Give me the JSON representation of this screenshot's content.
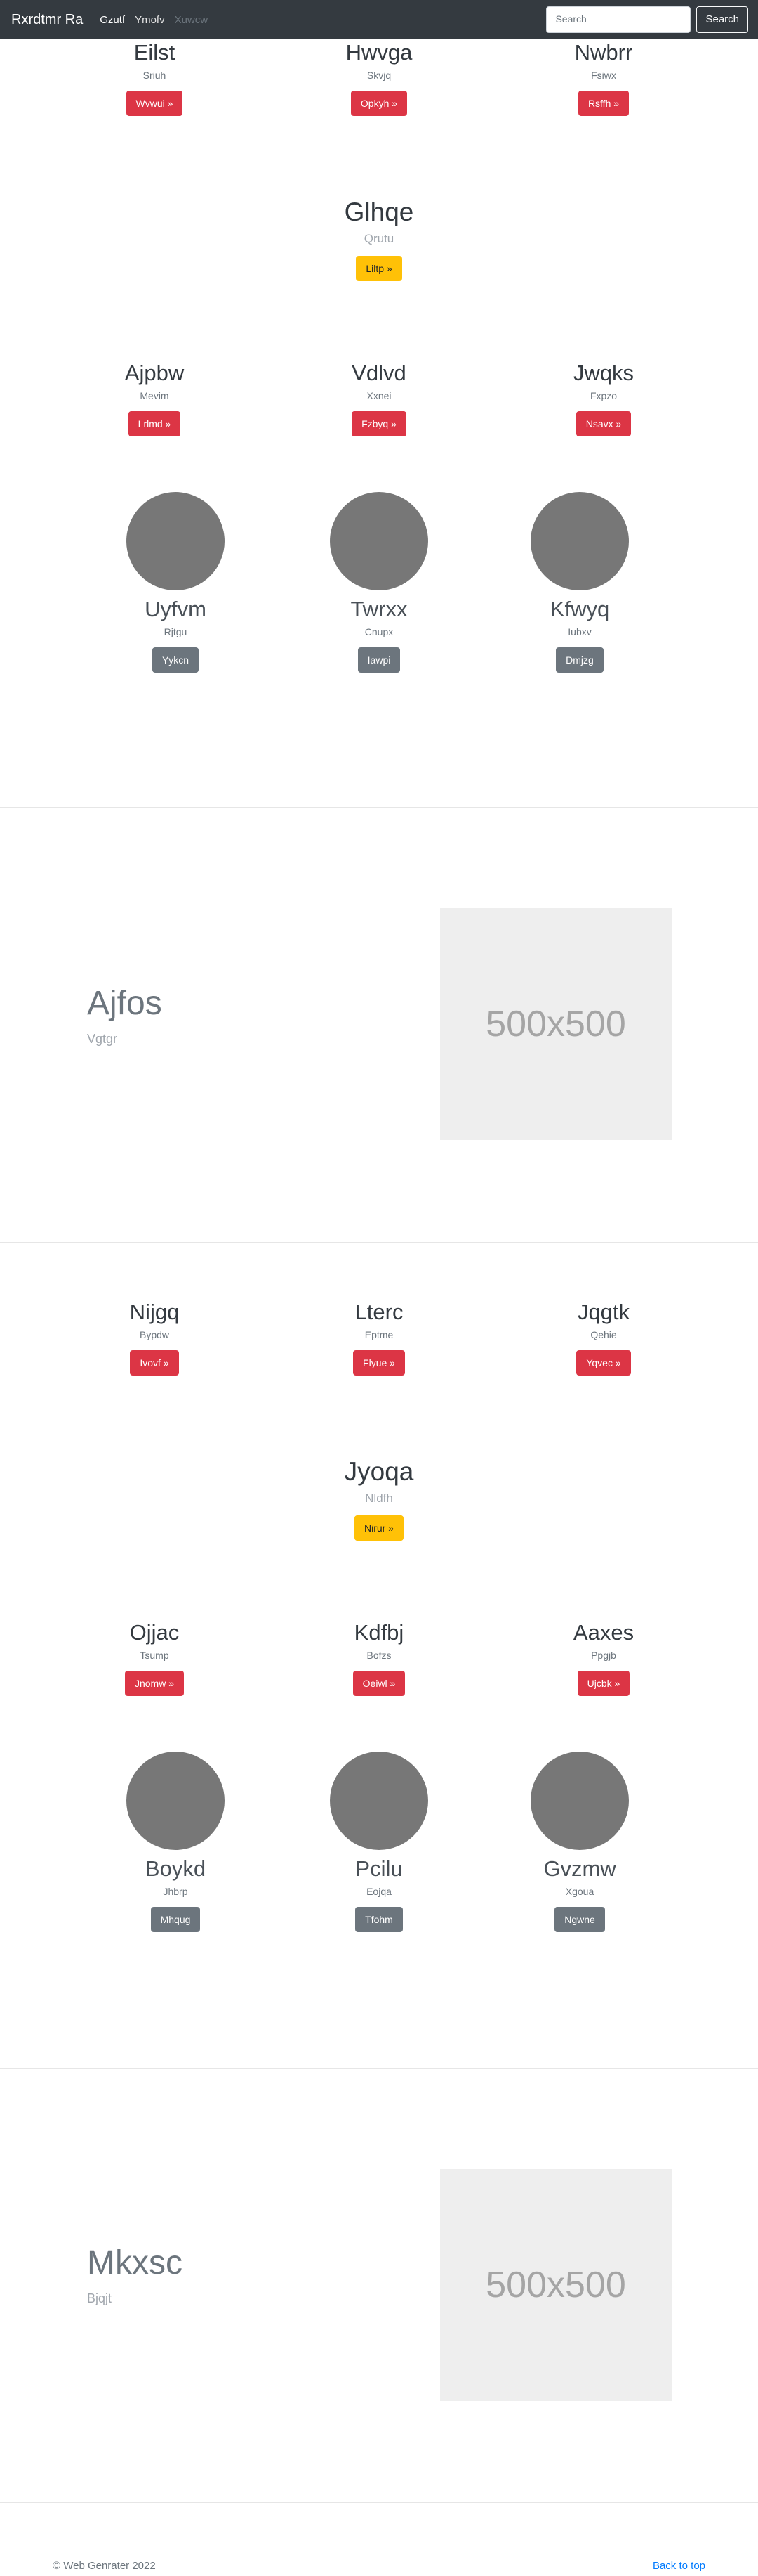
{
  "navbar": {
    "brand": "Rxrdtmr Ra",
    "links": [
      "Gzutf",
      "Ymofv",
      "Xuwcw"
    ],
    "search_placeholder": "Search",
    "search_button": "Search"
  },
  "section1": {
    "row1": [
      {
        "title": "Eilst",
        "sub": "Sriuh",
        "button": "Wvwui »"
      },
      {
        "title": "Hwvga",
        "sub": "Skvjq",
        "button": "Opkyh »"
      },
      {
        "title": "Nwbrr",
        "sub": "Fsiwx",
        "button": "Rsffh »"
      }
    ],
    "center": {
      "title": "Glhqe",
      "sub": "Qrutu",
      "button": "Liltp »"
    },
    "row2": [
      {
        "title": "Ajpbw",
        "sub": "Mevim",
        "button": "Lrlmd »"
      },
      {
        "title": "Vdlvd",
        "sub": "Xxnei",
        "button": "Fzbyq »"
      },
      {
        "title": "Jwqks",
        "sub": "Fxpzo",
        "button": "Nsavx »"
      }
    ],
    "avatars": [
      {
        "title": "Uyfvm",
        "sub": "Rjtgu",
        "button": "Yykcn"
      },
      {
        "title": "Twrxx",
        "sub": "Cnupx",
        "button": "Iawpi"
      },
      {
        "title": "Kfwyq",
        "sub": "Iubxv",
        "button": "Dmjzg"
      }
    ]
  },
  "feature1": {
    "title": "Ajfos",
    "sub": "Vgtgr",
    "placeholder": "500x500"
  },
  "section2": {
    "row1": [
      {
        "title": "Nijgq",
        "sub": "Bypdw",
        "button": "Ivovf »"
      },
      {
        "title": "Lterc",
        "sub": "Eptme",
        "button": "Flyue »"
      },
      {
        "title": "Jqgtk",
        "sub": "Qehie",
        "button": "Yqvec »"
      }
    ],
    "center": {
      "title": "Jyoqa",
      "sub": "Nldfh",
      "button": "Nirur »"
    },
    "row2": [
      {
        "title": "Ojjac",
        "sub": "Tsump",
        "button": "Jnomw »"
      },
      {
        "title": "Kdfbj",
        "sub": "Bofzs",
        "button": "Oeiwl »"
      },
      {
        "title": "Aaxes",
        "sub": "Ppgjb",
        "button": "Ujcbk »"
      }
    ],
    "avatars": [
      {
        "title": "Boykd",
        "sub": "Jhbrp",
        "button": "Mhqug"
      },
      {
        "title": "Pcilu",
        "sub": "Eojqa",
        "button": "Tfohm"
      },
      {
        "title": "Gvzmw",
        "sub": "Xgoua",
        "button": "Ngwne"
      }
    ]
  },
  "feature2": {
    "title": "Mkxsc",
    "sub": "Bjqjt",
    "placeholder": "500x500"
  },
  "footer": {
    "copyright": "© Web Genrater 2022",
    "back_to_top": "Back to top"
  }
}
